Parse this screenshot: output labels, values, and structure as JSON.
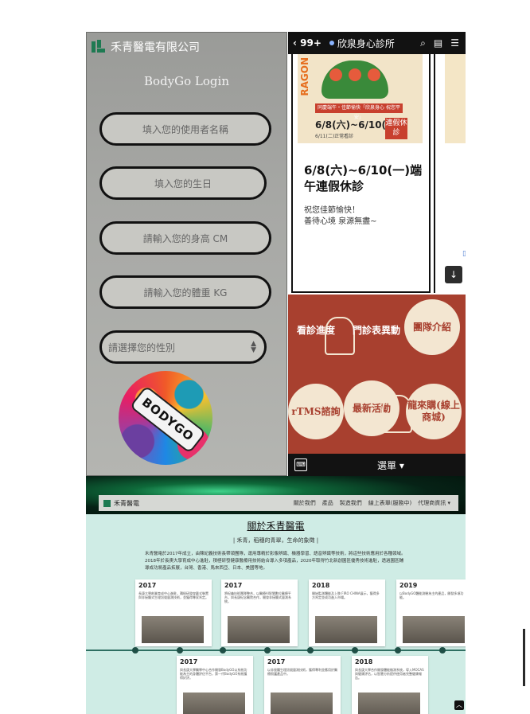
{
  "login": {
    "brand": "禾青醫電有限公司",
    "title": "BodyGo Login",
    "username_placeholder": "填入您的使用者名稱",
    "birthday_placeholder": "填入您的生日",
    "height_placeholder": "請輸入您的身高 CM",
    "weight_placeholder": "請輸入您的體重 KG",
    "gender_select": "請選擇您的性別",
    "badge_text": "BODYGO"
  },
  "clinic": {
    "back_label": "99+",
    "name": "欣泉身心診所",
    "poster": {
      "side_word": "RAGON",
      "banner": "同慶端午・佳節愉快「欣泉身心 祝您平安」",
      "dates": "6/8(六)~6/10(一)",
      "closed": "連假休診",
      "sub": "6/11(二)正常看診"
    },
    "post_title": "6/8(六)~6/10(一)端午連假休診",
    "post_body_line1": "祝您佳節愉快！",
    "post_body_line2": "善待心境 泉源無盡~",
    "menu_items": [
      "看診進度",
      "門診表異動",
      "團隊介紹",
      "rTMS諮詢",
      "最新活動",
      "龍來購(線上商城)"
    ],
    "bottom_menu": "選單 ▾"
  },
  "website": {
    "brand": "禾青醫電",
    "nav_links": [
      "關於我們",
      "產品",
      "製造我們",
      "線上表單(服務中)",
      "代理商資訊 ▾"
    ],
    "about_heading": "關於禾青醫電",
    "about_sub": "| 禾青，稻穗的青翠，生命的象徵 |",
    "intro": "禾青醫電於2017年成立，由陳紀義技術長帶領團隊，運用專精於影像辨識、機器學習、語音辨識等技術，將這些技術應用於各種領域。2018年於長庚大學育成中心進駐，積極研發健康醫療用技術結合導入多項產品，2020年取得竹北新創園區優秀技術進駐，透過園區輔導成功將產品拓展，台灣、香港、馬來西亞、日本、美國等地。",
    "timeline_top": [
      {
        "year": "2017",
        "desc": "長庚大學創業育成中心進駐，積極研發穿戴式裝置與非接觸式生理訊號量測技術，並獲得專家肯定。"
      },
      {
        "year": "2017",
        "desc": "將紀義技術團隊整合，以醫療AI智慧數位醫療平台，與長庚紀念醫院合作，開發非接觸式量測系統。"
      },
      {
        "year": "2018",
        "desc": "開始監測體能及上肢 FIRO CHINA展示，獲得多方肯定並成功進入市場。"
      },
      {
        "year": "2019",
        "desc": "以BodyGO體能測驗為主的產品，開發多項功能。"
      }
    ],
    "timeline_bottom": [
      {
        "year": "2017",
        "desc": "與長庚大學醫學中心合作開發BodyGO以系統功能為主的身體評估平台，第一代BodyGO系統獲得好評。"
      },
      {
        "year": "2017",
        "desc": "以非接觸生理訊號量測技術，獲得專利並應用於醫療照護產品中。"
      },
      {
        "year": "2018",
        "desc": "與長庚大學合作開發體能檢測系統，導入MOCAS與健康評估，以智慧分析提供使用者完整健康報告。"
      }
    ]
  }
}
